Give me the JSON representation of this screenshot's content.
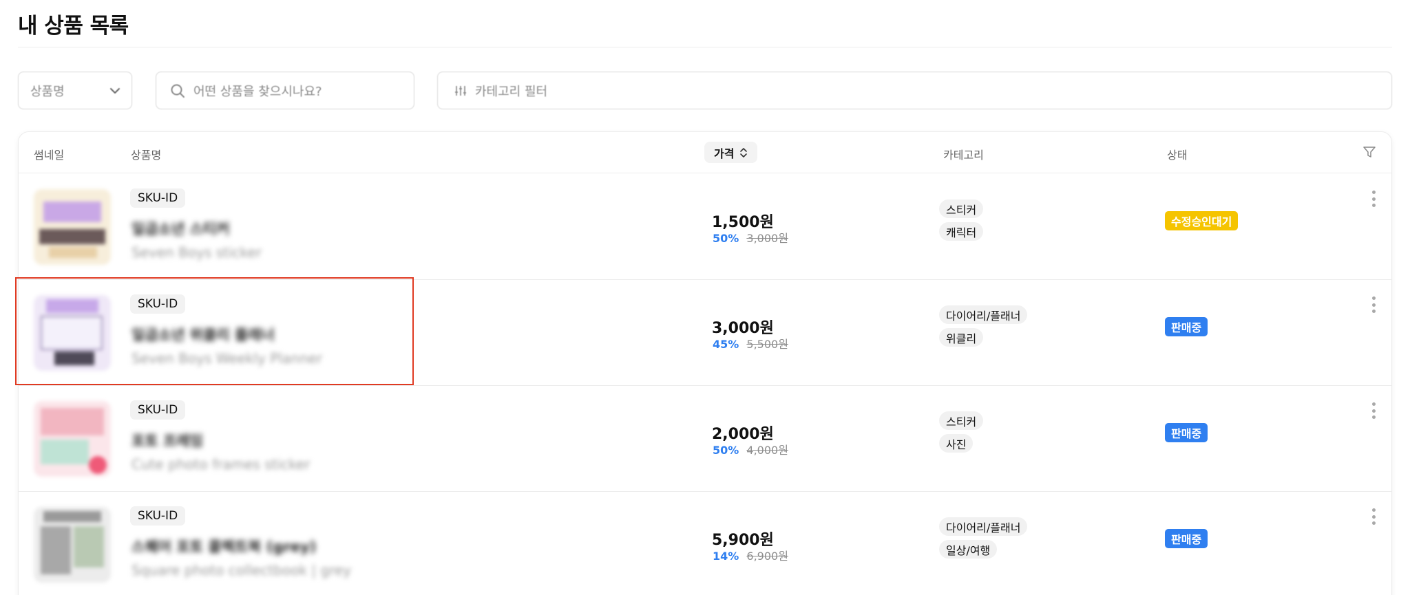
{
  "page": {
    "title": "내 상품 목록"
  },
  "filters": {
    "select_value": "상품명",
    "search_placeholder": "어떤 상품을 찾으시나요?",
    "category_placeholder": "카테고리 필터"
  },
  "table": {
    "headers": {
      "thumbnail": "썸네일",
      "name": "상품명",
      "price": "가격",
      "category": "카테고리",
      "status": "상태"
    },
    "rows": [
      {
        "sku": "SKU-ID",
        "name": "일곱소년 스티커",
        "name_en": "Seven Boys sticker",
        "price": "1,500원",
        "discount": "50%",
        "original_price": "3,000원",
        "categories": [
          "스티커",
          "캐릭터"
        ],
        "status": "수정승인대기",
        "status_color": "#f5c400"
      },
      {
        "sku": "SKU-ID",
        "name": "일곱소년 위클리 플래너",
        "name_en": "Seven Boys Weekly Planner",
        "price": "3,000원",
        "discount": "45%",
        "original_price": "5,500원",
        "categories": [
          "다이어리/플래너",
          "위클리"
        ],
        "status": "판매중",
        "status_color": "#2f7ff0"
      },
      {
        "sku": "SKU-ID",
        "name": "포토 프레임",
        "name_en": "Cute photo frames sticker",
        "price": "2,000원",
        "discount": "50%",
        "original_price": "4,000원",
        "categories": [
          "스티커",
          "사진"
        ],
        "status": "판매중",
        "status_color": "#2f7ff0"
      },
      {
        "sku": "SKU-ID",
        "name": "스퀘어 포토 콜렉트북 (grey)",
        "name_en": "Square photo collectbook | grey",
        "price": "5,900원",
        "discount": "14%",
        "original_price": "6,900원",
        "categories": [
          "다이어리/플래너",
          "일상/여행"
        ],
        "status": "판매중",
        "status_color": "#2f7ff0"
      }
    ]
  },
  "colors": {
    "accent_blue": "#2f7ff0",
    "pending_yellow": "#f5c400",
    "highlight_red": "#e03a22"
  },
  "icons": {
    "select_caret": "chevron-down-icon",
    "search": "search-icon",
    "category_filter": "sliders-icon",
    "sort": "sort-icon",
    "column_filter": "funnel-icon",
    "row_menu": "more-vertical-icon"
  }
}
